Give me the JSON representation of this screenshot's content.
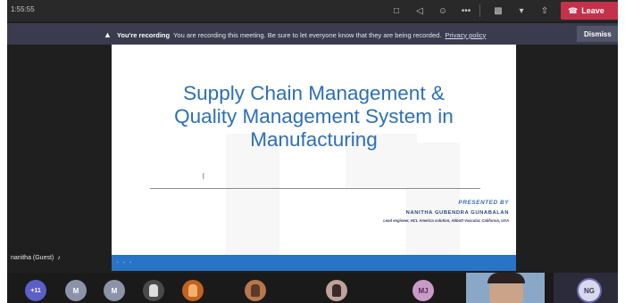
{
  "topbar": {
    "timer": "1:55:55",
    "leave_label": "Leave"
  },
  "recording": {
    "title": "You're recording",
    "message": "You are recording this meeting. Be sure to let everyone know that they are being recorded.",
    "privacy_link": "Privacy policy",
    "dismiss_label": "Dismiss"
  },
  "slide": {
    "title_lines": [
      "Supply Chain Management &",
      "Quality Management System in",
      "Manufacturing"
    ],
    "presented_by": "PRESENTED BY",
    "presenter_name": "NANITHA GUBENDRA GUNABALAN",
    "presenter_role": "Lead engineer, HCL America solution, Abbott Vascular, California, USA"
  },
  "stage_label": "nanitha (Guest)",
  "participants": {
    "more_count": "+11",
    "initials": [
      "M",
      "M",
      "MJ"
    ],
    "self_initials": "NG"
  },
  "colors": {
    "leave": "#c4314b",
    "accent": "#5b5fc7",
    "slide_title": "#2d6fb5",
    "slide_footer": "#2a74c8"
  }
}
